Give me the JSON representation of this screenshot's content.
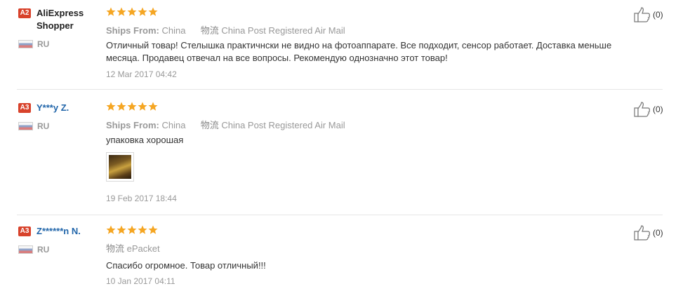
{
  "reviews": [
    {
      "level": "A2",
      "buyer": "AliExpress Shopper",
      "country": "RU",
      "stars": 5,
      "ships_from_label": "Ships From:",
      "ships_from": "China",
      "logistics_icon": "物流",
      "logistics": "China Post Registered Air Mail",
      "text": "Отличный товар! Стелышка практичнски не видно на фотоаппарате. Все подходит, сенсор работает. Доставка меньше месяца. Продавец отвечал на все вопросы. Рекомендую однозначно этот товар!",
      "date": "12 Mar 2017 04:42",
      "helpful": "(0)"
    },
    {
      "level": "A3",
      "buyer": "Y***y Z.",
      "country": "RU",
      "stars": 5,
      "ships_from_label": "Ships From:",
      "ships_from": "China",
      "logistics_icon": "物流",
      "logistics": "China Post Registered Air Mail",
      "text": "упаковка хорошая",
      "date": "19 Feb 2017 18:44",
      "helpful": "(0)"
    },
    {
      "level": "A3",
      "buyer": "Z******n N.",
      "country": "RU",
      "stars": 5,
      "logistics_icon": "物流",
      "logistics": "ePacket",
      "text": "Спасибо огромное. Товар отличный!!!",
      "date": "10 Jan 2017 04:11",
      "helpful": "(0)"
    }
  ],
  "colors": {
    "star": "#f5a623",
    "level_badge": "#d8422b",
    "masked_name": "#2266aa",
    "meta_text": "#999999"
  },
  "icons": {
    "star": "star-icon",
    "thumbs_up": "thumbs-up-icon",
    "flag": "flag-ru-icon"
  }
}
